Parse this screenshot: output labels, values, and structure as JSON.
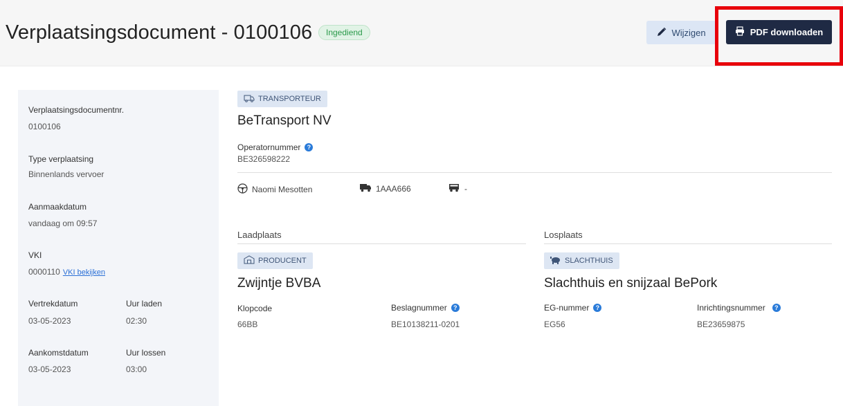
{
  "header": {
    "title": "Verplaatsingsdocument - 0100106",
    "status": "Ingediend",
    "edit_label": "Wijzigen",
    "pdf_label": "PDF downloaden"
  },
  "sidebar": {
    "docnr_label": "Verplaatsingsdocumentnr.",
    "docnr_value": "0100106",
    "type_label": "Type verplaatsing",
    "type_value": "Binnenlands vervoer",
    "created_label": "Aanmaakdatum",
    "created_value": "vandaag om 09:57",
    "vki_label": "VKI",
    "vki_value": "0000110",
    "vki_link": "VKI bekijken",
    "departure_label": "Vertrekdatum",
    "departure_value": "03-05-2023",
    "load_time_label": "Uur laden",
    "load_time_value": "02:30",
    "arrival_label": "Aankomstdatum",
    "arrival_value": "03-05-2023",
    "unload_time_label": "Uur lossen",
    "unload_time_value": "03:00"
  },
  "transporter": {
    "tag": "TRANSPORTEUR",
    "name": "BeTransport NV",
    "operator_label": "Operatornummer",
    "operator_value": "BE326598222",
    "driver": "Naomi Mesotten",
    "truck_plate": "1AAA666",
    "trailer_plate": "-"
  },
  "loading": {
    "section": "Laadplaats",
    "tag": "PRODUCENT",
    "name": "Zwijntje BVBA",
    "field1_label": "Klopcode",
    "field1_value": "66BB",
    "field2_label": "Beslagnummer",
    "field2_value": "BE10138211-0201"
  },
  "unloading": {
    "section": "Losplaats",
    "tag": "SLACHTHUIS",
    "name": "Slachthuis en snijzaal BePork",
    "field1_label": "EG-nummer",
    "field1_value": "EG56",
    "field2_label": "Inrichtingsnummer",
    "field2_value": "BE23659875"
  },
  "colors": {
    "primary_button": "#1f2a44",
    "secondary_button": "#dce6f5",
    "status_green": "#2a9a4a",
    "highlight_red": "#e8000b",
    "info_blue": "#2a7bd9"
  },
  "icons": {
    "edit": "pencil-icon",
    "pdf": "printer-icon",
    "transporter": "truck-outline-icon",
    "producer": "barn-icon",
    "slaughterhouse": "pig-icon",
    "driver": "steering-wheel-icon",
    "truck": "truck-icon",
    "trailer": "trailer-icon",
    "info": "info-icon"
  }
}
